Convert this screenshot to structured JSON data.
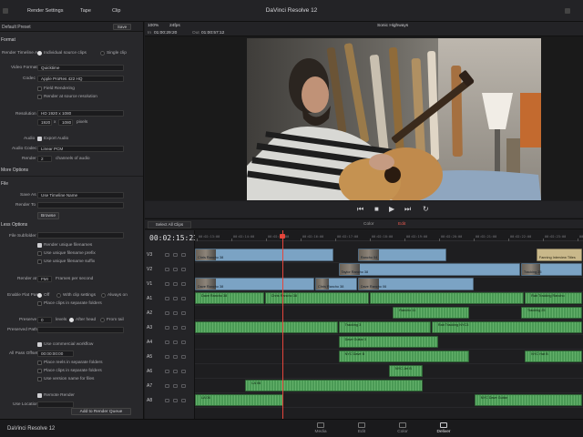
{
  "titlebar": {
    "render_settings": "Render Settings",
    "tape": "Tape",
    "clip": "Clip",
    "app_title": "DaVinci Resolve 12"
  },
  "left_panel": {
    "preset": "Default Preset",
    "save": "Save",
    "format_section": "Format",
    "render_timeline_as": "Render Timeline As",
    "individual_clips": "Individual source clips",
    "single_clip": "Single clip",
    "video_format_label": "Video Format",
    "video_format": "Quicktime",
    "codec_label": "Codec",
    "codec": "Apple ProRes 422 HQ",
    "field_rendering": "Field Rendering",
    "render_at_source": "Render at source resolution",
    "resolution_label": "Resolution",
    "resolution": "HD 1920 x 1080",
    "width": "1920",
    "x": "x",
    "height": "1080",
    "pixels": "pixels",
    "audio_label": "Audio",
    "export_audio": "Export Audio",
    "audio_codec_label": "Audio Codec",
    "audio_codec": "Linear PCM",
    "render_label": "Render",
    "channels": "2",
    "channels_of_audio": "channels of audio",
    "more_options": "More Options",
    "file_section": "File",
    "save_as_label": "Save As",
    "save_as": "Use Timeline Name",
    "render_to_label": "Render To",
    "browse": "Browse",
    "less_options": "Less Options",
    "file_subfolder": "File Subfolder",
    "render_unique": "Render unique filenames",
    "use_unique_prefix": "Use unique filename prefix",
    "use_unique_suffix": "Use unique filename suffix",
    "render_at_label": "Render at",
    "render_at_fps": "FMI",
    "frames_per_second": "Frames per second",
    "enable_flat_pass": "Enable Flat Pass",
    "off": "Off",
    "with_clip_settings": "With clip settings",
    "always_on": "Always on",
    "place_clips_separate": "Place clips in separate folders",
    "preserve_label": "Preserve",
    "preserve_value": "0",
    "levels": "levels",
    "after_head": "After head",
    "from_tail": "From tail",
    "preserved_path": "Preserved Path",
    "use_commercial": "Use commercial workflow",
    "all_pass_offset": "All Pass Offset",
    "offset_value": "00:00:00:00",
    "place_reels": "Place reels in separate folders",
    "place_clips_folders": "Place clips in separate folders",
    "use_version_names": "Use version name for files",
    "remote_render": "Remote Render",
    "use_render_flag": "Use Location",
    "add_to_queue": "Add to Render Queue"
  },
  "viewer": {
    "zoom": "100%",
    "fps": "24fps",
    "timeline_name": "Sonic Highways",
    "tc_in_label": "In",
    "tc_in": "01:00:29:20",
    "tc_out_label": "Out",
    "tc_out": "01:00:57:12"
  },
  "transport": {
    "prev": "⏮",
    "stop": "■",
    "play": "▶",
    "next": "⏭",
    "loop": "↻"
  },
  "timeline": {
    "select_all": "Select All Clips",
    "tab_color": "Color",
    "tab_edit": "Edit",
    "timecode": "00:02:15:23",
    "tracks": [
      "V3",
      "V2",
      "V1",
      "A1",
      "A2",
      "A3",
      "A4",
      "A5",
      "A6",
      "A7",
      "A8"
    ],
    "ruler_ticks": [
      "00:02:13:00",
      "00:02:14:00",
      "00:02:15:00",
      "00:02:16:00",
      "00:02:17:00",
      "00:02:18:00",
      "00:02:19:00",
      "00:02:20:00",
      "00:02:21:00",
      "00:02:22:00",
      "00:02:23:00",
      "00:02:24:00"
    ],
    "video_clips": [
      {
        "track": 0,
        "start": 0,
        "end": 36,
        "label": "Chris Rancho 38"
      },
      {
        "track": 0,
        "start": 42,
        "end": 65,
        "label": "Rancho 04"
      },
      {
        "track": 0,
        "start": 88,
        "end": 100,
        "label": "Fanning Interview Titles",
        "title": true
      },
      {
        "track": 1,
        "start": 37,
        "end": 84,
        "label": "Taylor Rancho 38"
      },
      {
        "track": 1,
        "start": 84,
        "end": 100,
        "label": "Tracking 25"
      },
      {
        "track": 2,
        "start": 0,
        "end": 31,
        "label": "Dave Rancho 38"
      },
      {
        "track": 2,
        "start": 31,
        "end": 42,
        "label": "Chris Rancho 38"
      },
      {
        "track": 2,
        "start": 42,
        "end": 72,
        "label": "Dave Rancho 06"
      }
    ],
    "audio_clips": [
      {
        "track": 3,
        "start": 0,
        "end": 18,
        "label": "Dave Rancho 38"
      },
      {
        "track": 3,
        "start": 18,
        "end": 45,
        "label": "Chris Rancho 38"
      },
      {
        "track": 3,
        "start": 45,
        "end": 85,
        "label": ""
      },
      {
        "track": 3,
        "start": 85,
        "end": 100,
        "label": "Rab Tracking Rancho"
      },
      {
        "track": 4,
        "start": 51,
        "end": 71,
        "label": "Rancho 11"
      },
      {
        "track": 4,
        "start": 84,
        "end": 100,
        "label": "Tracking 25"
      },
      {
        "track": 5,
        "start": 0,
        "end": 37,
        "label": ""
      },
      {
        "track": 5,
        "start": 37,
        "end": 61,
        "label": "Tracking 3"
      },
      {
        "track": 5,
        "start": 61,
        "end": 100,
        "label": "Rab Tracking NYC3"
      },
      {
        "track": 6,
        "start": 37,
        "end": 63,
        "label": "Dave Guitar 3"
      },
      {
        "track": 7,
        "start": 37,
        "end": 71,
        "label": "NYC Dave B"
      },
      {
        "track": 7,
        "start": 85,
        "end": 100,
        "label": "NYC Hat B"
      },
      {
        "track": 8,
        "start": 50,
        "end": 59,
        "label": "NYC Jet B"
      },
      {
        "track": 9,
        "start": 13,
        "end": 59,
        "label": "LA 06"
      },
      {
        "track": 10,
        "start": 0,
        "end": 23,
        "label": "LA 06"
      },
      {
        "track": 10,
        "start": 72,
        "end": 100,
        "label": "NYC Dave Guitar"
      }
    ]
  },
  "bottombar": {
    "logo": "DaVinci Resolve 12",
    "pages": [
      "Media",
      "Edit",
      "Color",
      "Deliver"
    ]
  }
}
